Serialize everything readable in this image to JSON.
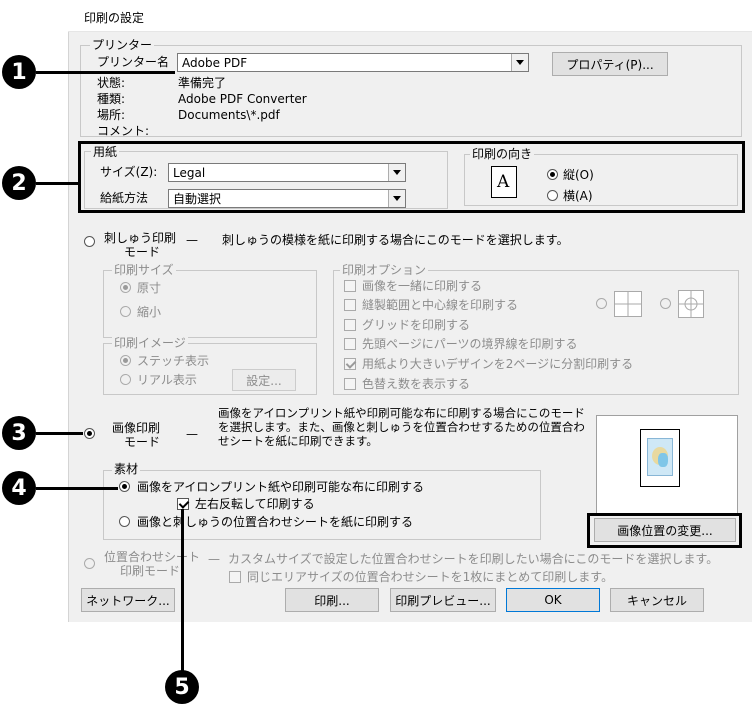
{
  "title": "印刷の設定",
  "printer": {
    "group": "プリンター",
    "name_label": "プリンター名",
    "name_value": "Adobe PDF",
    "properties_button": "プロパティ(P)...",
    "status_label": "状態:",
    "status_value": "準備完了",
    "type_label": "種類:",
    "type_value": "Adobe PDF Converter",
    "location_label": "場所:",
    "location_value": "Documents\\*.pdf",
    "comment_label": "コメント:"
  },
  "paper": {
    "group": "用紙",
    "size_label": "サイズ(Z):",
    "size_value": "Legal",
    "source_label": "給紙方法",
    "source_value": "自動選択"
  },
  "orientation": {
    "group": "印刷の向き",
    "portrait": "縦(O)",
    "landscape": "横(A)",
    "icon_letter": "A"
  },
  "embroidery_mode": {
    "label_line1": "刺しゅう印刷",
    "label_line2": "モード",
    "dash": "—",
    "description": "刺しゅうの模様を紙に印刷する場合にこのモードを選択します。",
    "print_size": {
      "group": "印刷サイズ",
      "actual": "原寸",
      "reduced": "縮小"
    },
    "print_image": {
      "group": "印刷イメージ",
      "stitch": "ステッチ表示",
      "real": "リアル表示",
      "settings_button": "設定..."
    },
    "print_options": {
      "group": "印刷オプション",
      "items": [
        "画像を一緒に印刷する",
        "縫製範囲と中心線を印刷する",
        "グリッドを印刷する",
        "先頭ページにパーツの境界線を印刷する",
        "用紙より大きいデザインを2ページに分割印刷する",
        "色替え数を表示する"
      ]
    }
  },
  "image_mode": {
    "label_line1": "画像印刷",
    "label_line2": "モード",
    "dash": "—",
    "description": "画像をアイロンプリント紙や印刷可能な布に印刷する場合にこのモードを選択します。また、画像と刺しゅうを位置合わせするための位置合わせシートを紙に印刷できます。",
    "material": {
      "group": "素材",
      "option1": "画像をアイロンプリント紙や印刷可能な布に印刷する",
      "mirror": "左右反転して印刷する",
      "option2": "画像と刺しゅうの位置合わせシートを紙に印刷する"
    },
    "change_position_button": "画像位置の変更..."
  },
  "alignment_mode": {
    "label_line1": "位置合わせシート",
    "label_line2": "印刷モード",
    "dash": "—",
    "description": "カスタムサイズで設定した位置合わせシートを印刷したい場合にこのモードを選択します。",
    "same_area": "同じエリアサイズの位置合わせシートを1枚にまとめて印刷します。"
  },
  "buttons": {
    "network": "ネットワーク...",
    "print": "印刷...",
    "preview": "印刷プレビュー...",
    "ok": "OK",
    "cancel": "キャンセル"
  },
  "callouts": [
    "1",
    "2",
    "3",
    "4",
    "5"
  ]
}
